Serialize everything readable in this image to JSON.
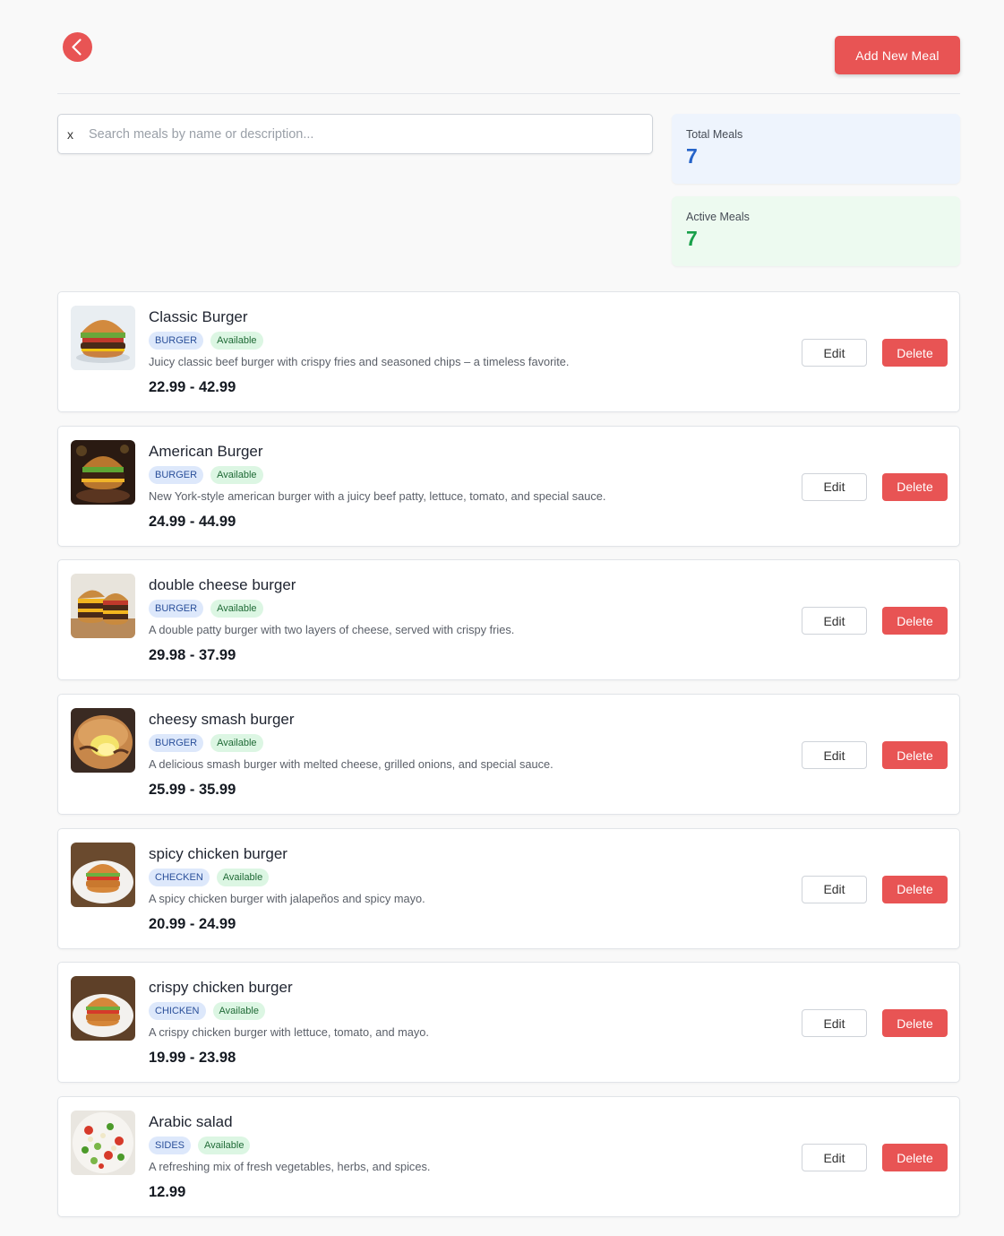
{
  "header": {
    "back_icon": "chevron-left-icon",
    "add_button_label": "Add New Meal"
  },
  "search": {
    "clear_label": "x",
    "placeholder": "Search meals by name or description...",
    "value": ""
  },
  "stats": {
    "total_label": "Total Meals",
    "total_value": "7",
    "active_label": "Active Meals",
    "active_value": "7"
  },
  "colors": {
    "accent": "#e85454",
    "total_blue": "#2563c9",
    "active_green": "#18a04a"
  },
  "actions": {
    "edit_label": "Edit",
    "delete_label": "Delete"
  },
  "meals": [
    {
      "name": "Classic Burger",
      "category": "BURGER",
      "status": "Available",
      "description": "Juicy classic beef burger with crispy fries and seasoned chips – a timeless favorite.",
      "price": "22.99 - 42.99",
      "image": "burger"
    },
    {
      "name": "American Burger",
      "category": "BURGER",
      "status": "Available",
      "description": "New York-style american burger with a juicy beef patty, lettuce, tomato, and special sauce.",
      "price": "24.99 - 44.99",
      "image": "burger-dark"
    },
    {
      "name": "double cheese burger",
      "category": "BURGER",
      "status": "Available",
      "description": "A double patty burger with two layers of cheese, served with crispy fries.",
      "price": "29.98 - 37.99",
      "image": "burger-double"
    },
    {
      "name": "cheesy smash burger",
      "category": "BURGER",
      "status": "Available",
      "description": "A delicious smash burger with melted cheese, grilled onions, and special sauce.",
      "price": "25.99 - 35.99",
      "image": "burger-smash"
    },
    {
      "name": "spicy chicken burger",
      "category": "CHECKEN",
      "status": "Available",
      "description": "A spicy chicken burger with jalapeños and spicy mayo.",
      "price": "20.99 - 24.99",
      "image": "chicken-burger"
    },
    {
      "name": "crispy chicken burger",
      "category": "CHICKEN",
      "status": "Available",
      "description": "A crispy chicken burger with lettuce, tomato, and mayo.",
      "price": "19.99 - 23.98",
      "image": "chicken-burger"
    },
    {
      "name": "Arabic salad",
      "category": "SIDES",
      "status": "Available",
      "description": "A refreshing mix of fresh vegetables, herbs, and spices.",
      "price": "12.99",
      "image": "salad"
    }
  ]
}
